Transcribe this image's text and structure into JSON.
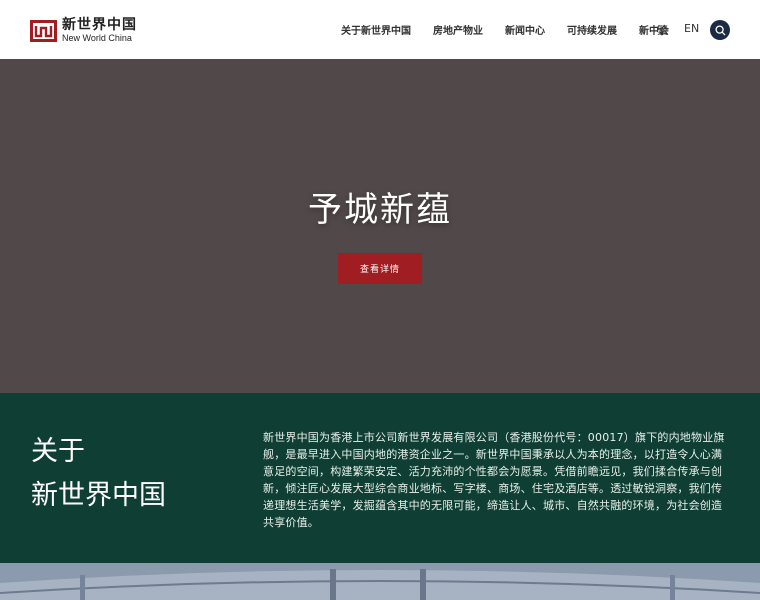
{
  "header": {
    "logo_cn": "新世界中国",
    "logo_en": "New World China",
    "nav": [
      "关于新世界中国",
      "房地产物业",
      "新闻中心",
      "可持续发展",
      "新中会"
    ],
    "lang_traditional": "繁",
    "lang_en": "EN"
  },
  "hero": {
    "title": "予城新蕴",
    "button": "查看详情"
  },
  "about": {
    "heading_line1": "关于",
    "heading_line2": "新世界中国",
    "body": "新世界中国为香港上市公司新世界发展有限公司（香港股份代号：00017）旗下的内地物业旗舰，是最早进入中国内地的港资企业之一。新世界中国秉承以人为本的理念，以打造令人心满意足的空间，构建繁荣安定、活力充沛的个性都会为愿景。凭借前瞻远见，我们揉合传承与创新，倾注匠心发展大型综合商业地标、写字楼、商场、住宅及酒店等。透过敏锐洞察，我们传递理想生活美学，发掘蕴含其中的无限可能，缔造让人、城市、自然共融的环境，为社会创造共享价值。"
  },
  "colors": {
    "brand_red": "#a01d22",
    "hero_bg": "#514849",
    "about_bg": "#0f3f34",
    "search_bg": "#1b2b45"
  }
}
